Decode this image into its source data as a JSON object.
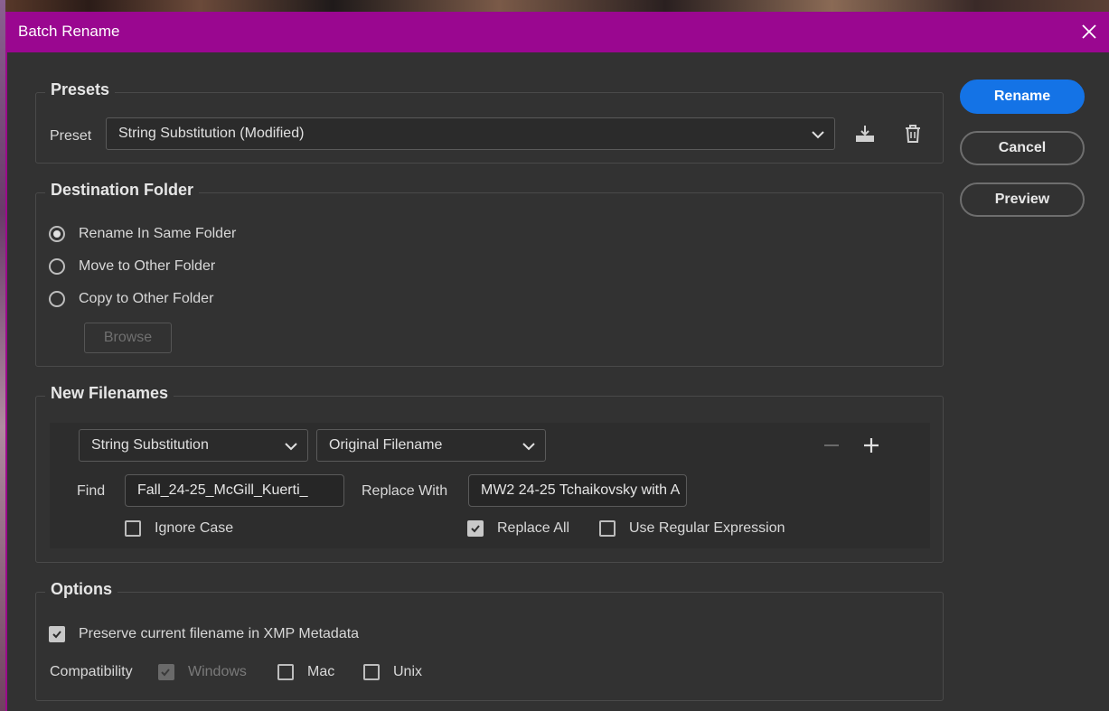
{
  "dialog": {
    "title": "Batch Rename"
  },
  "buttons": {
    "rename": "Rename",
    "cancel": "Cancel",
    "preview": "Preview"
  },
  "presets": {
    "group_title": "Presets",
    "preset_label": "Preset",
    "preset_value": "String Substitution (Modified)",
    "save_icon": "save-preset-icon",
    "delete_icon": "trash-icon"
  },
  "destination": {
    "group_title": "Destination Folder",
    "options": [
      {
        "label": "Rename In Same Folder",
        "selected": true
      },
      {
        "label": "Move to Other Folder",
        "selected": false
      },
      {
        "label": "Copy to Other Folder",
        "selected": false
      }
    ],
    "browse_label": "Browse"
  },
  "new_filenames": {
    "group_title": "New Filenames",
    "type_value": "String Substitution",
    "source_value": "Original Filename",
    "find_label": "Find",
    "find_value": "Fall_24-25_McGill_Kuerti_",
    "replace_label": "Replace With",
    "replace_value": "MW2 24-25 Tchaikovsky with A",
    "ignore_case_label": "Ignore Case",
    "ignore_case": false,
    "replace_all_label": "Replace All",
    "replace_all": true,
    "regex_label": "Use Regular Expression",
    "regex": false
  },
  "options": {
    "group_title": "Options",
    "preserve_label": "Preserve current filename in XMP Metadata",
    "preserve": true,
    "compat_label": "Compatibility",
    "windows_label": "Windows",
    "windows": true,
    "mac_label": "Mac",
    "mac": false,
    "unix_label": "Unix",
    "unix": false
  },
  "colors": {
    "titlebar": "#9a0790",
    "primary": "#1473e6",
    "background": "#323232"
  }
}
